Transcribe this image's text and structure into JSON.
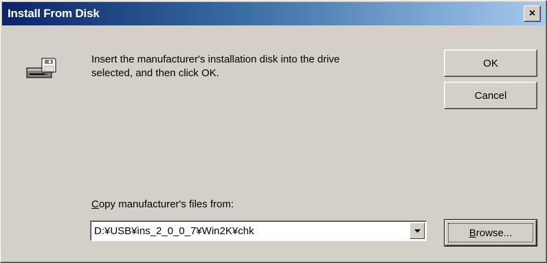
{
  "window": {
    "title": "Install From Disk",
    "close_glyph": "×"
  },
  "message": {
    "line1": "Insert the manufacturer's installation disk into the drive",
    "line2": "selected, and then click OK."
  },
  "buttons": {
    "ok": "OK",
    "cancel": "Cancel",
    "browse_accel": "B",
    "browse_rest": "rowse..."
  },
  "copy_from": {
    "label_accel": "C",
    "label_rest": "opy manufacturer's files from:",
    "value": "D:¥USB¥ins_2_0_0_7¥Win2K¥chk"
  },
  "icons": {
    "disk": "disk-drive-icon",
    "dropdown": "chevron-down-icon",
    "close": "close-icon"
  },
  "colors": {
    "face": "#d4d0c8",
    "title_start": "#0a246a",
    "title_end": "#a6caf0"
  }
}
